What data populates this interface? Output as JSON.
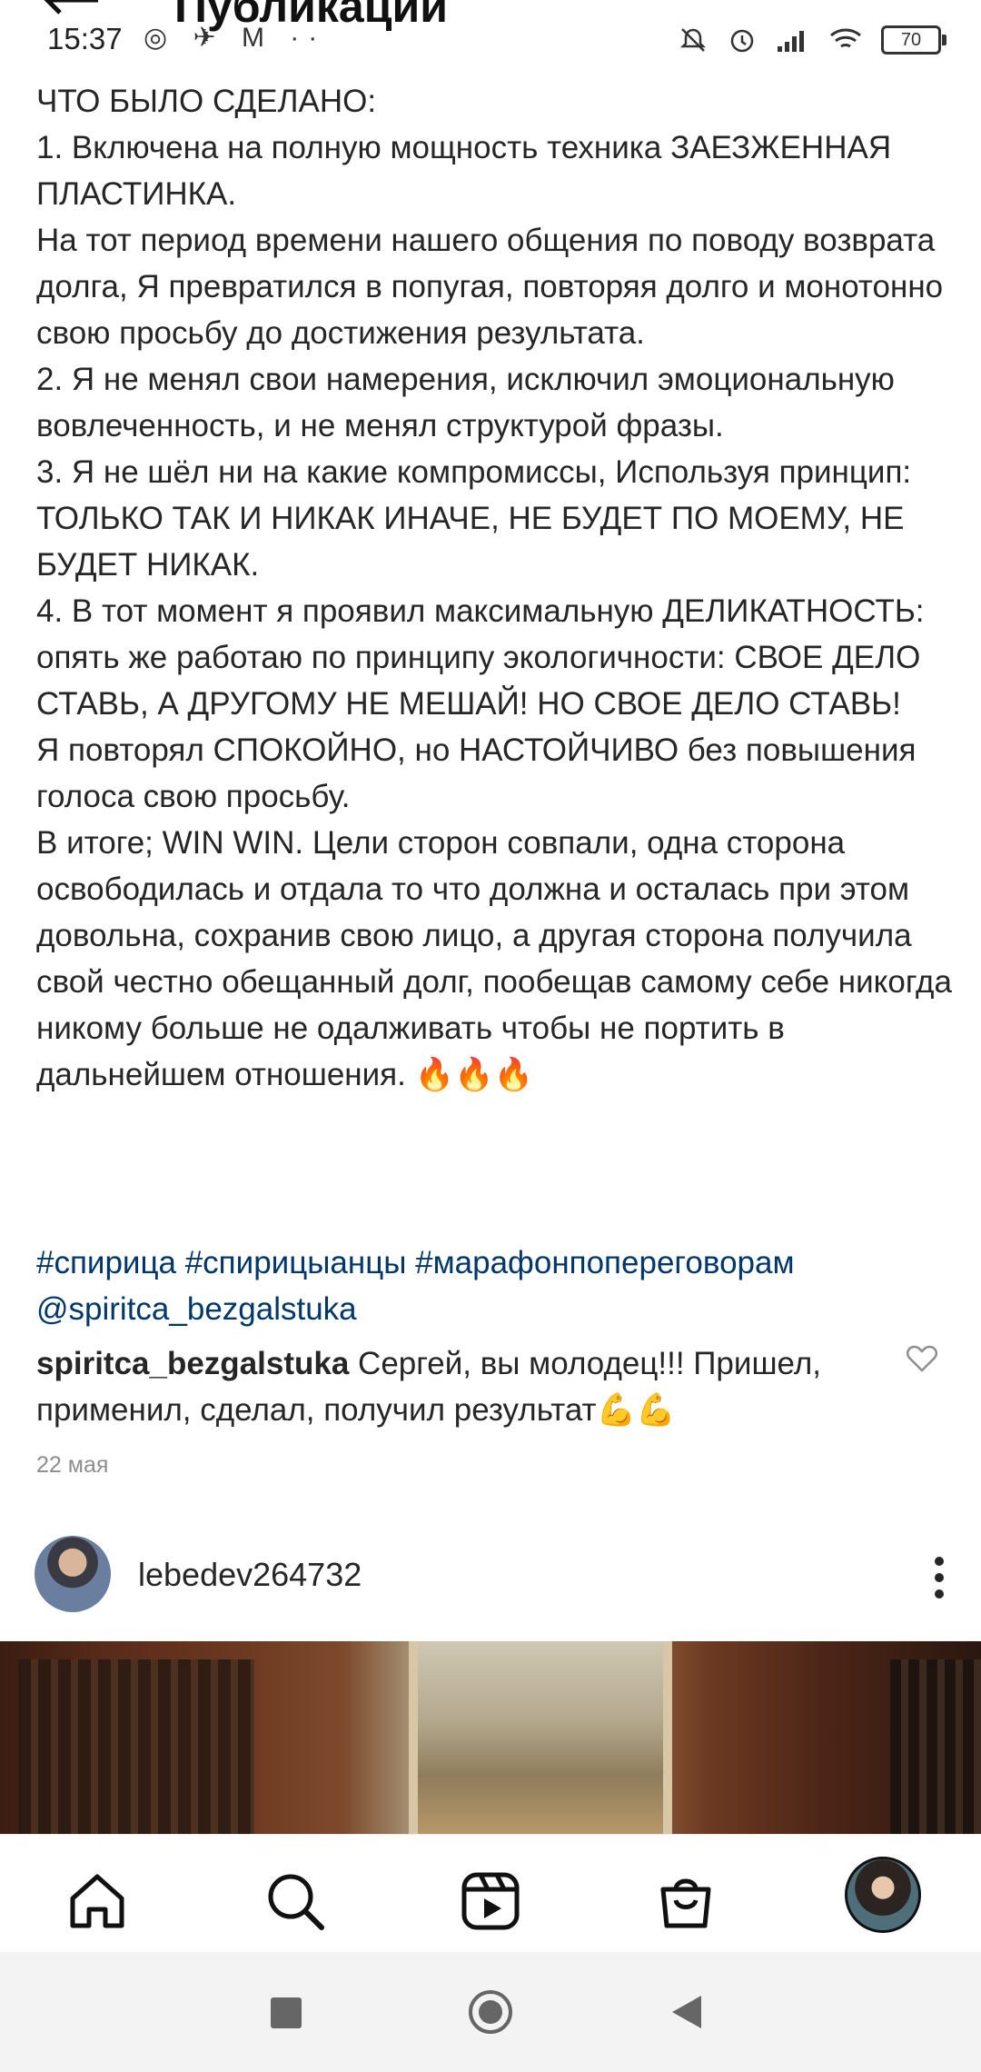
{
  "status_bar": {
    "time": "15:37",
    "left_icons": [
      "instagram-icon",
      "telegram-icon",
      "gmail-icon",
      "more-dots"
    ],
    "battery": "70"
  },
  "header": {
    "title": "Публикации"
  },
  "post": {
    "caption": "ЧТО БЫЛО СДЕЛАНО:\n1. Включена на полную мощность техника ЗАЕЗЖЕННАЯ ПЛАСТИНКА.\nНа тот период времени нашего общения по поводу возврата долга, Я превратился в попугая, повторяя долго и монотонно свою просьбу до достижения результата.\n2. Я не менял свои намерения, исключил эмоциональную вовлеченность, и не менял структурой фразы.\n3. Я не шёл ни на какие компромиссы, Используя принцип: ТОЛЬКО ТАК И НИКАК ИНАЧЕ, НЕ БУДЕТ ПО МОЕМУ, НЕ БУДЕТ НИКАК.\n4. В тот момент я проявил максимальную ДЕЛИКАТНОСТЬ: опять же работаю по принципу экологичности: СВОЕ ДЕЛО СТАВЬ, А ДРУГОМУ НЕ МЕШАЙ! НО СВОЕ ДЕЛО СТАВЬ!\nЯ повторял СПОКОЙНО, но НАСТОЙЧИВО без повышения голоса свою просьбу.\nВ итоге; WIN WIN. Цели сторон совпали, одна сторона освободилась и отдала то что должна и осталась при этом довольна, сохранив свою лицо, а другая сторона получила свой честно обещанный долг, пообещав самому себе никогда никому больше не одалживать чтобы не портить в дальнейшем отношения. 🔥🔥🔥",
    "hashtags": "#спирица #спирицыанцы #марафонпопереговорам @spiritca_bezgalstuka",
    "comment": {
      "user": "spiritca_bezgalstuka",
      "text": " Сергей, вы молодец!!! Пришел, применил, сделал, получил результат💪💪"
    },
    "date": "22 мая"
  },
  "next_post": {
    "username": "lebedev264732"
  },
  "bottom_nav": {
    "items": [
      "home-icon",
      "search-icon",
      "reels-icon",
      "shop-icon",
      "profile-avatar"
    ]
  }
}
